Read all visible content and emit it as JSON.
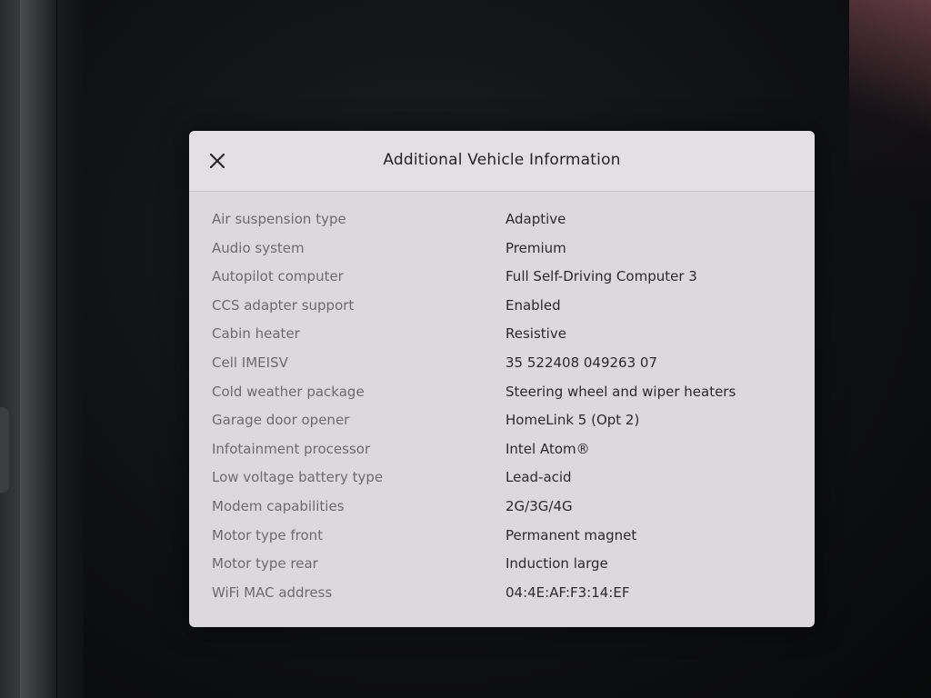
{
  "modal": {
    "title": "Additional Vehicle Information",
    "close_icon": "close-icon"
  },
  "rows": [
    {
      "label": "Air suspension type",
      "value": "Adaptive"
    },
    {
      "label": "Audio system",
      "value": "Premium"
    },
    {
      "label": "Autopilot computer",
      "value": "Full Self-Driving Computer 3"
    },
    {
      "label": "CCS adapter support",
      "value": "Enabled"
    },
    {
      "label": "Cabin heater",
      "value": "Resistive"
    },
    {
      "label": "Cell IMEISV",
      "value": "35 522408 049263 07"
    },
    {
      "label": "Cold weather package",
      "value": "Steering wheel and wiper heaters"
    },
    {
      "label": "Garage door opener",
      "value": "HomeLink 5 (Opt 2)"
    },
    {
      "label": "Infotainment processor",
      "value": "Intel Atom®"
    },
    {
      "label": "Low voltage battery type",
      "value": "Lead-acid"
    },
    {
      "label": "Modem capabilities",
      "value": "2G/3G/4G"
    },
    {
      "label": "Motor type front",
      "value": "Permanent magnet"
    },
    {
      "label": "Motor type rear",
      "value": "Induction large"
    },
    {
      "label": "WiFi MAC address",
      "value": "04:4E:AF:F3:14:EF"
    }
  ],
  "colors": {
    "modal_background": "#dcd9dc",
    "label_text": "#6c6b70",
    "value_text": "#2a2a2c",
    "screen_background": "#0b0b0c"
  }
}
